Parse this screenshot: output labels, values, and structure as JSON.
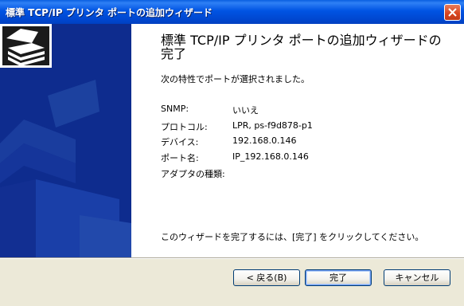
{
  "window": {
    "title": "標準 TCP/IP プリンタ ポートの追加ウィザード"
  },
  "content": {
    "heading": "標準 TCP/IP プリンタ ポートの追加ウィザードの完了",
    "intro": "次の特性でポートが選択されました。",
    "properties": [
      {
        "label": "SNMP:",
        "value": "いいえ"
      },
      {
        "label": "プロトコル:",
        "value": "LPR, ps-f9d878-p1"
      },
      {
        "label": "デバイス:",
        "value": "192.168.0.146"
      },
      {
        "label": "ポート名:",
        "value": "IP_192.168.0.146"
      },
      {
        "label": "アダプタの種類:",
        "value": ""
      }
    ],
    "footer": "このウィザードを完了するには、[完了] をクリックしてください。"
  },
  "buttons": {
    "back": "< 戻る(B)",
    "finish": "完了",
    "cancel": "キャンセル"
  },
  "colors": {
    "titlebar": "#0054e3",
    "sidebar": "#0e2c8e",
    "close": "#d8431e"
  }
}
